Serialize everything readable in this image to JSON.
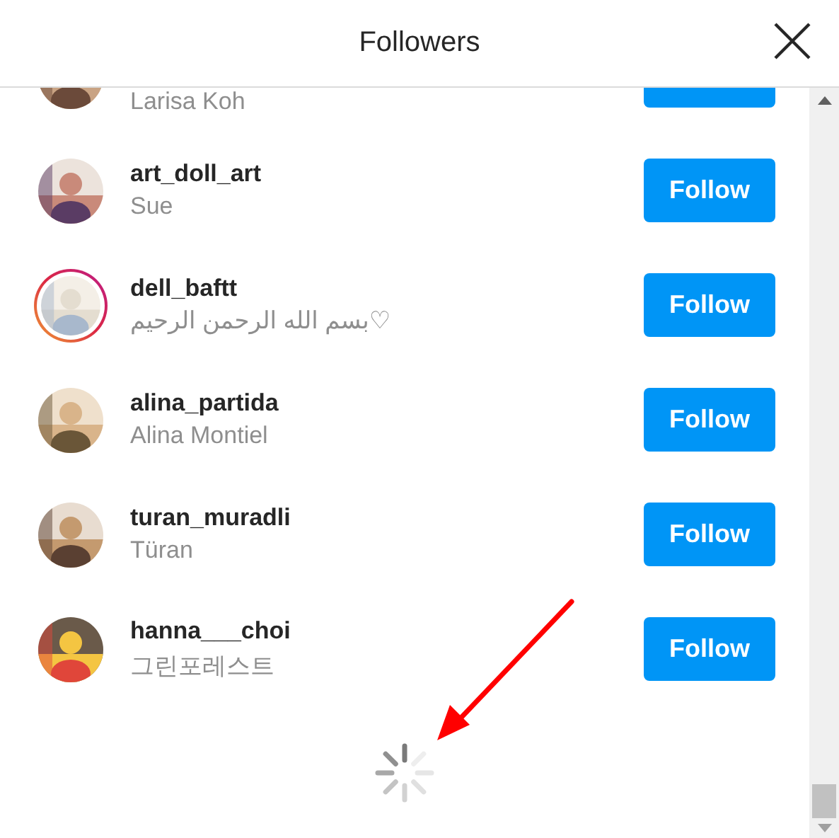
{
  "header": {
    "title": "Followers"
  },
  "followers": [
    {
      "kind": "partial",
      "name": "Larisa Koh",
      "story_ring": false
    },
    {
      "kind": "full",
      "username": "art_doll_art",
      "name": "Sue",
      "story_ring": false,
      "button": "Follow"
    },
    {
      "kind": "full",
      "username": "dell_baftt",
      "name": "بسم الله الرحمن الرحيم♡",
      "story_ring": true,
      "button": "Follow"
    },
    {
      "kind": "full",
      "username": "alina_partida",
      "name": "Alina Montiel",
      "story_ring": false,
      "button": "Follow"
    },
    {
      "kind": "full",
      "username": "turan_muradli",
      "name": "Türan",
      "story_ring": false,
      "button": "Follow"
    },
    {
      "kind": "full",
      "username": "hanna___choi",
      "name": "그린포레스트",
      "story_ring": false,
      "button": "Follow"
    }
  ]
}
